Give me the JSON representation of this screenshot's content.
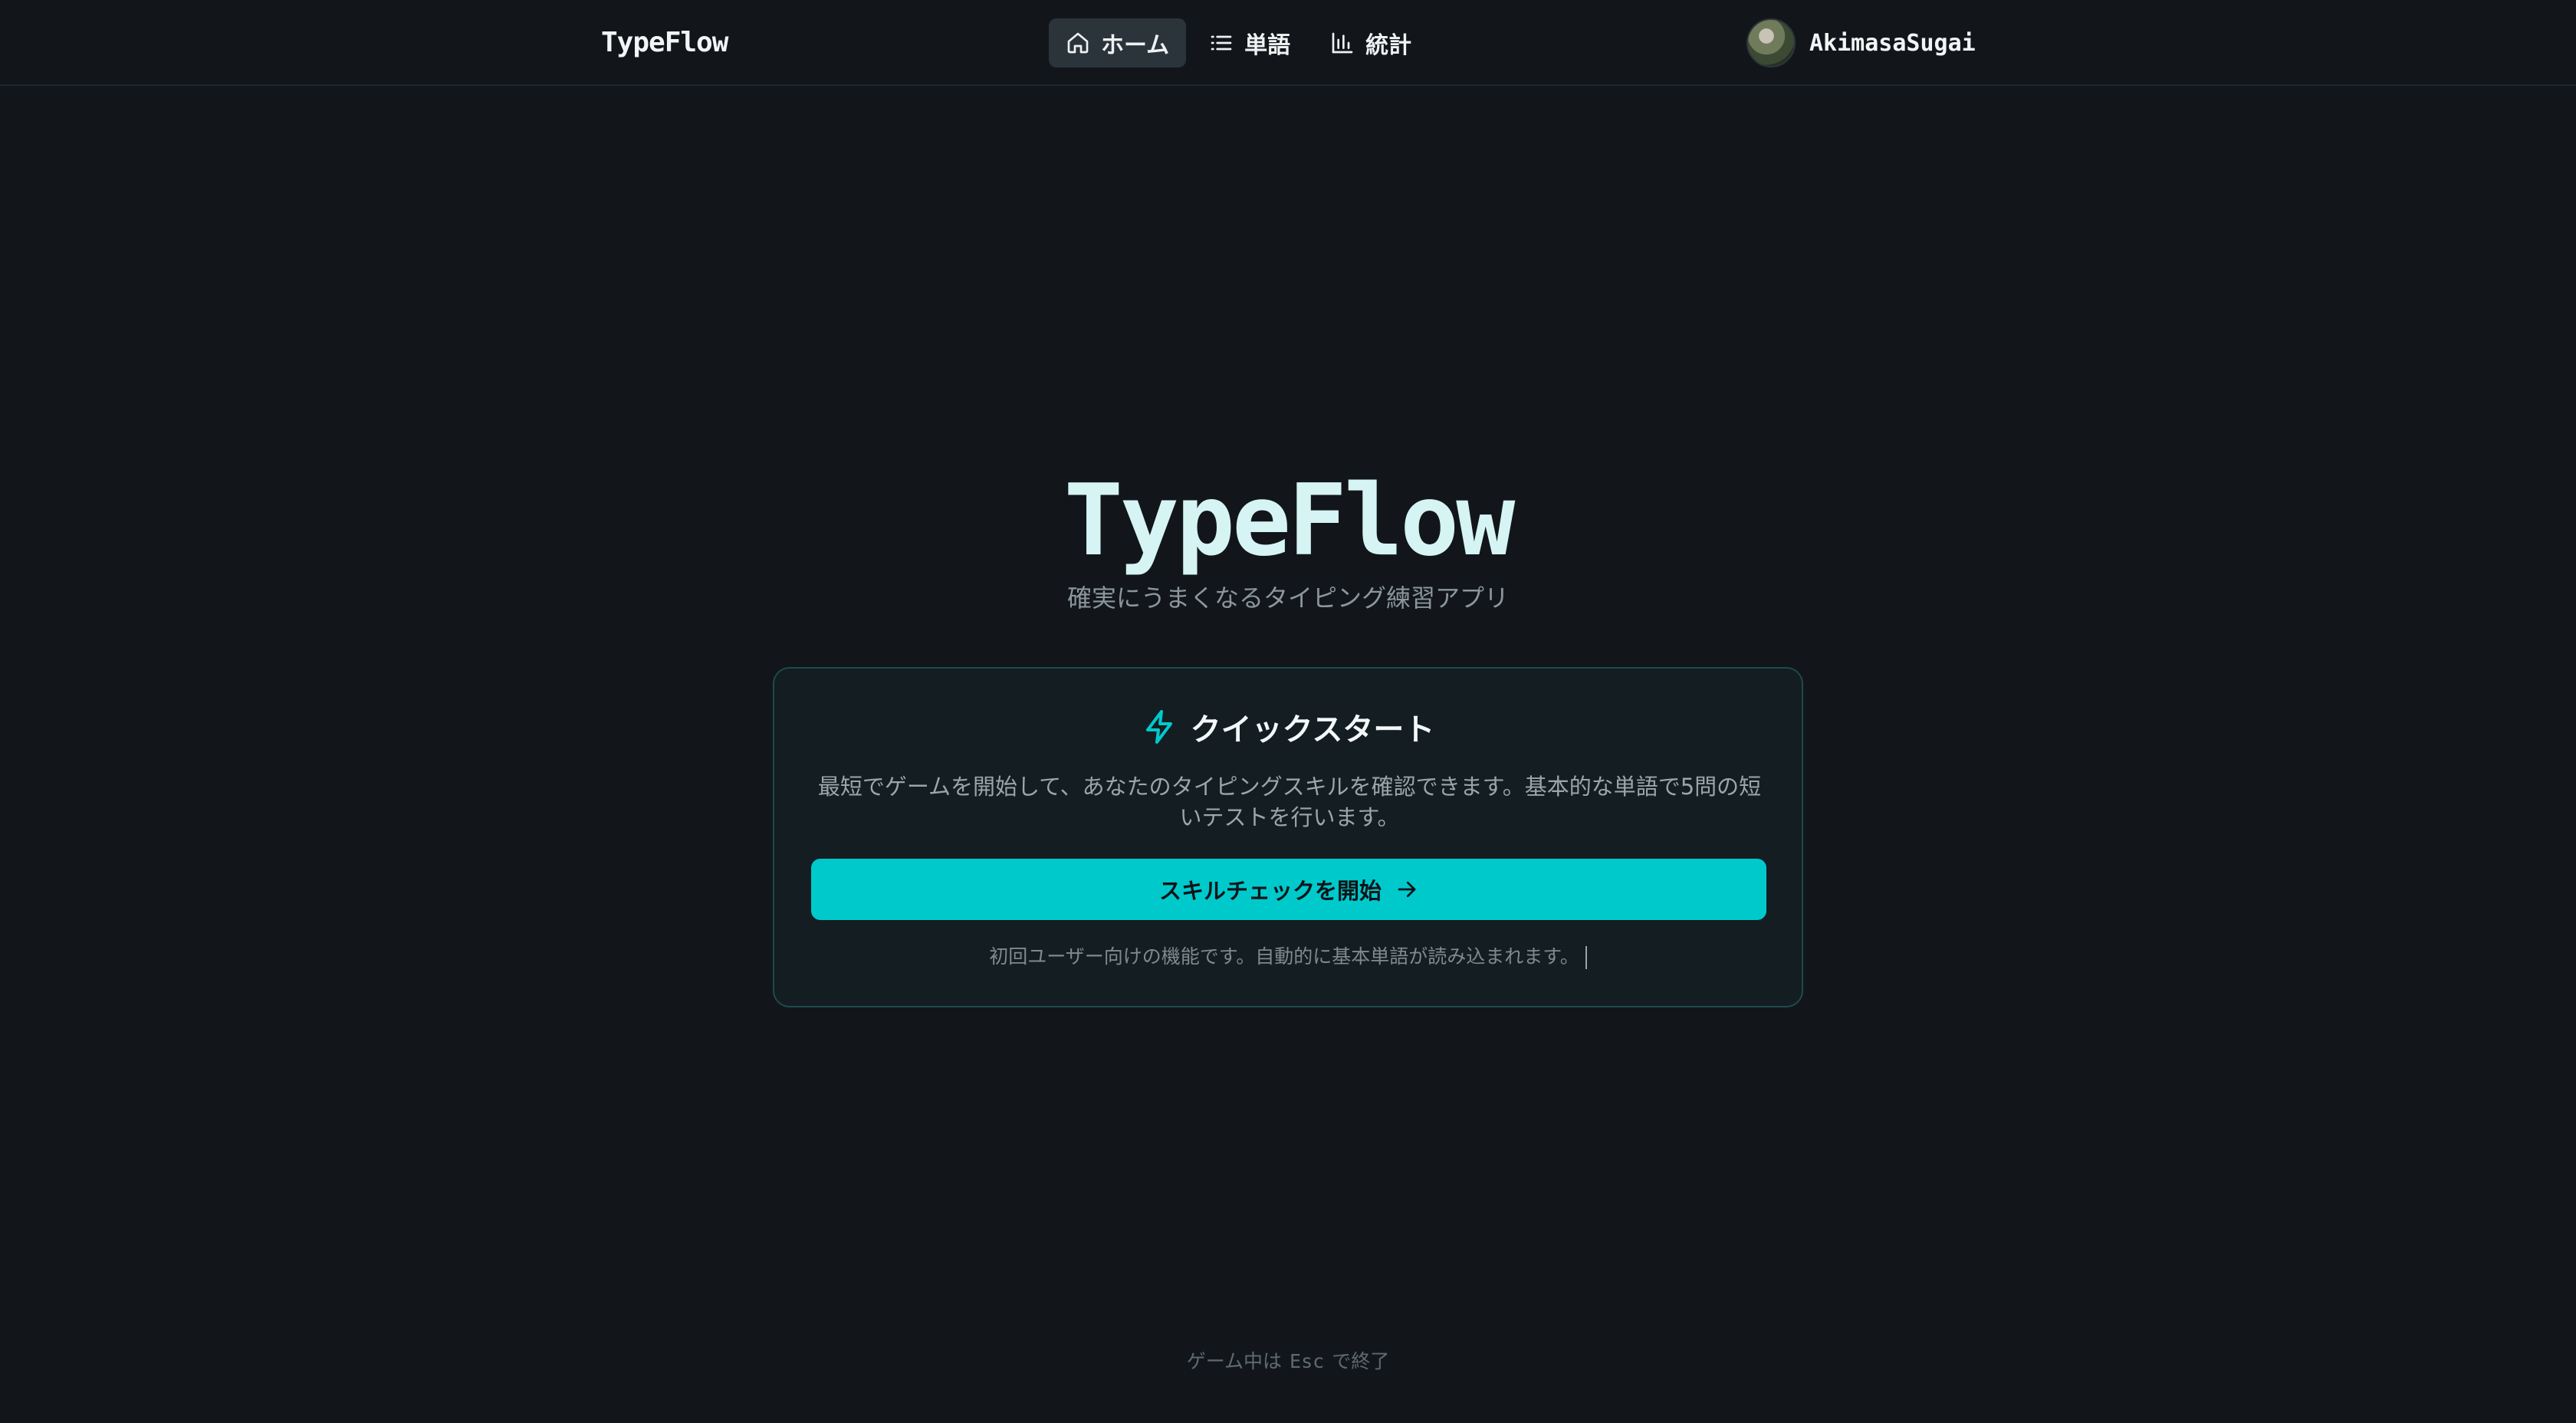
{
  "header": {
    "brand": "TypeFlow",
    "nav": [
      {
        "label": "ホーム",
        "icon": "home-icon",
        "active": true
      },
      {
        "label": "単語",
        "icon": "list-icon",
        "active": false
      },
      {
        "label": "統計",
        "icon": "bar-chart-icon",
        "active": false
      }
    ],
    "user": {
      "name": "AkimasaSugai"
    }
  },
  "hero": {
    "title": "TypeFlow",
    "subtitle": "確実にうまくなるタイピング練習アプリ"
  },
  "quickstart": {
    "title": "クイックスタート",
    "icon": "lightning-icon",
    "description": "最短でゲームを開始して、あなたのタイピングスキルを確認できます。基本的な単語で5問の短いテストを行います。",
    "button_label": "スキルチェックを開始",
    "note": "初回ユーザー向けの機能です。自動的に基本単語が読み込まれます。"
  },
  "footer": {
    "prefix": "ゲーム中は",
    "key": "Esc",
    "suffix": "で終了"
  },
  "colors": {
    "background": "#12161a",
    "accent": "#00c9cc",
    "card_border": "#1f4a4c"
  }
}
